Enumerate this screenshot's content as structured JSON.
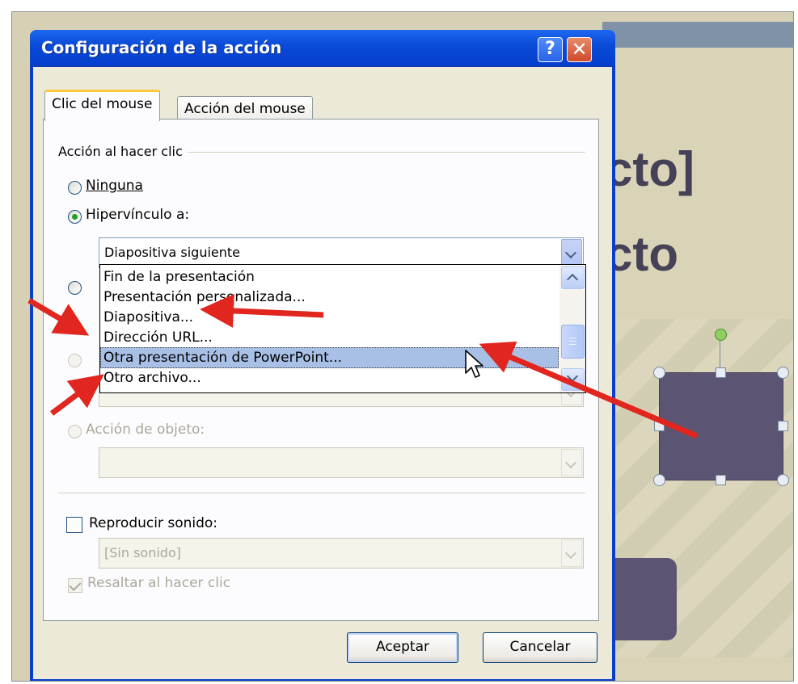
{
  "dialog": {
    "title": "Configuración de la acción",
    "help_label": "?",
    "close_label": "✕"
  },
  "tabs": [
    {
      "label": "Clic del mouse",
      "active": true
    },
    {
      "label": "Acción del mouse",
      "active": false
    }
  ],
  "group_label": "Acción al hacer clic",
  "options": {
    "none": "Ninguna",
    "hyperlink": "Hipervínculo a:",
    "hyperlink_selected": true,
    "object_action": "Acción de objeto:"
  },
  "hyperlink_combo": {
    "value": "Diapositiva siguiente"
  },
  "dropdown": {
    "items": [
      "Fin de la presentación",
      "Presentación personalizada...",
      "Diapositiva...",
      "Dirección URL...",
      "Otra presentación de PowerPoint...",
      "Otro archivo..."
    ],
    "selected_index": 4
  },
  "sound": {
    "checkbox_label": "Reproducir sonido:",
    "checked": false,
    "combo_value": "[Sin sonido]"
  },
  "highlight": {
    "label": "Resaltar al hacer clic",
    "checked": true
  },
  "buttons": {
    "ok": "Aceptar",
    "cancel": "Cancelar"
  },
  "slide": {
    "title_line1": "cto]",
    "title_line2": "cto"
  },
  "colors": {
    "titlebar": "#0a4bd8",
    "selection": "#a9c0e6",
    "slide_bg": "#d6d1b4",
    "shape": "#5b5573",
    "annotation_arrow": "#e0261e"
  }
}
